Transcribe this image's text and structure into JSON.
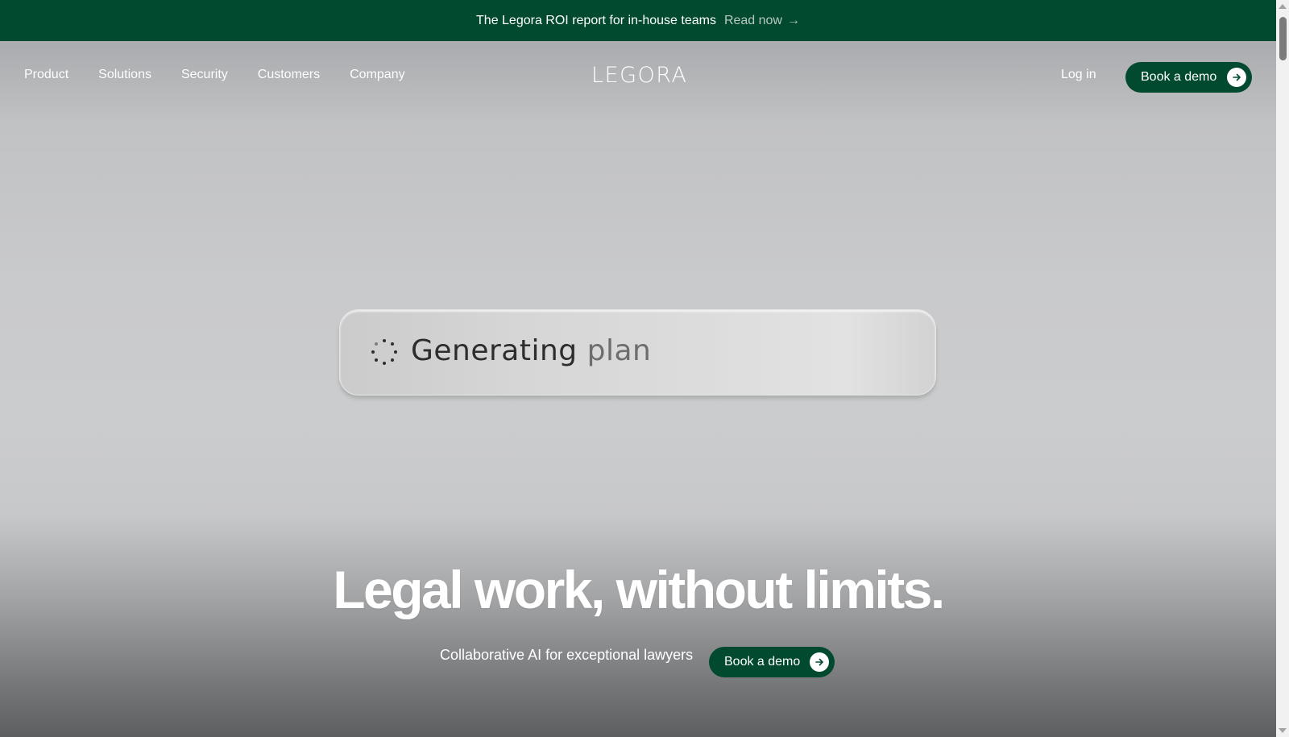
{
  "announcement": {
    "message": "The Legora ROI report for in-house teams",
    "link_label": "Read now",
    "arrow": "→"
  },
  "nav": {
    "items": [
      {
        "label": "Product"
      },
      {
        "label": "Solutions"
      },
      {
        "label": "Security"
      },
      {
        "label": "Customers"
      },
      {
        "label": "Company"
      }
    ],
    "logo": "LEGORA",
    "login_label": "Log in",
    "demo_label": "Book a demo"
  },
  "plan_card": {
    "status_main": "Generating",
    "status_dim": "plan",
    "icon": "loading-spinner-icon"
  },
  "hero": {
    "headline": "Legal work, without limits.",
    "subtitle": "Collaborative AI for exceptional lawyers",
    "demo_label": "Book a demo"
  },
  "colors": {
    "brand_green": "#014a2f",
    "white": "#ffffff"
  }
}
